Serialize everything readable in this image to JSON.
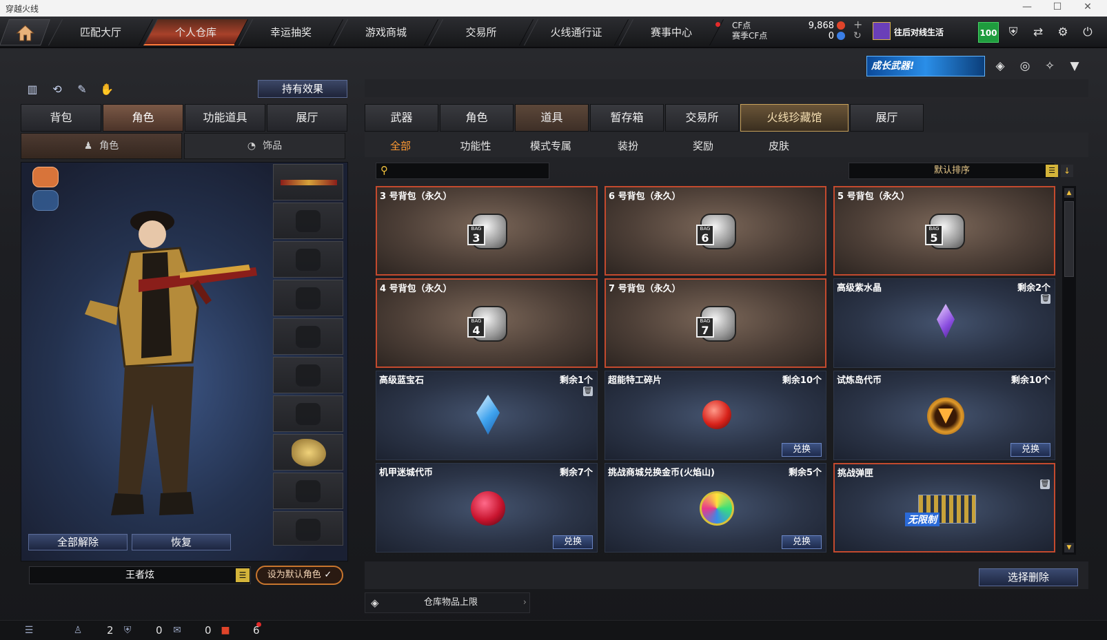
{
  "window": {
    "title": "穿越火线",
    "minimize": "—",
    "maximize": "☐",
    "close": "✕"
  },
  "nav": {
    "tabs": [
      "匹配大厅",
      "个人仓库",
      "幸运抽奖",
      "游戏商城",
      "交易所",
      "火线通行证",
      "赛事中心"
    ],
    "active": "个人仓库"
  },
  "currency": {
    "cf_label": "CF点",
    "season_label": "赛季CF点",
    "cf_value": "9,868",
    "season_value": "0",
    "plus": "+",
    "refresh": "↻"
  },
  "player": {
    "title": "往后对线生活",
    "level": "100"
  },
  "promo": {
    "label": "成长武器!"
  },
  "left": {
    "hold_effect": "持有效果",
    "tabs": [
      "背包",
      "角色",
      "功能道具",
      "展厅"
    ],
    "active_tab": "角色",
    "subtabs": [
      "角色",
      "饰品"
    ],
    "active_subtab": "角色",
    "unequip_all": "全部解除",
    "restore": "恢复",
    "character_name": "王者炫",
    "set_default": "设为默认角色"
  },
  "right": {
    "tabs": [
      "武器",
      "角色",
      "道具",
      "暂存箱",
      "交易所",
      "火线珍藏馆",
      "展厅"
    ],
    "active_tab": "道具",
    "highlight_tab": "火线珍藏馆",
    "filters": [
      "全部",
      "功能性",
      "模式专属",
      "装扮",
      "奖励",
      "皮肤"
    ],
    "active_filter": "全部",
    "search_placeholder": "",
    "sort_label": "默认排序",
    "items": [
      {
        "name": "3 号背包（永久）",
        "count": "",
        "bag": "3",
        "exchange": false
      },
      {
        "name": "6 号背包（永久）",
        "count": "",
        "bag": "6",
        "exchange": false
      },
      {
        "name": "5 号背包（永久）",
        "count": "",
        "bag": "5",
        "exchange": false
      },
      {
        "name": "4 号背包（永久）",
        "count": "",
        "bag": "4",
        "exchange": false
      },
      {
        "name": "7 号背包（永久）",
        "count": "",
        "bag": "7",
        "exchange": false
      },
      {
        "name": "高级紫水晶",
        "count": "剩余2个",
        "exchange": false
      },
      {
        "name": "高级蓝宝石",
        "count": "剩余1个",
        "exchange": false
      },
      {
        "name": "超能特工碎片",
        "count": "剩余10个",
        "exchange": true
      },
      {
        "name": "试炼岛代币",
        "count": "剩余10个",
        "exchange": true
      },
      {
        "name": "机甲迷城代币",
        "count": "剩余7个",
        "exchange": true
      },
      {
        "name": "挑战商城兑换金币(火焰山)",
        "count": "剩余5个",
        "exchange": true
      },
      {
        "name": "挑战弹匣",
        "count": "",
        "exchange": false,
        "badge": "无限制"
      }
    ],
    "exchange_label": "兑换",
    "bag_tag": "BAG",
    "delete_selected": "选择删除",
    "capacity_label": "仓库物品上限"
  },
  "statusbar": {
    "count1": "2",
    "count2": "0",
    "count3": "0",
    "count4": "6"
  }
}
